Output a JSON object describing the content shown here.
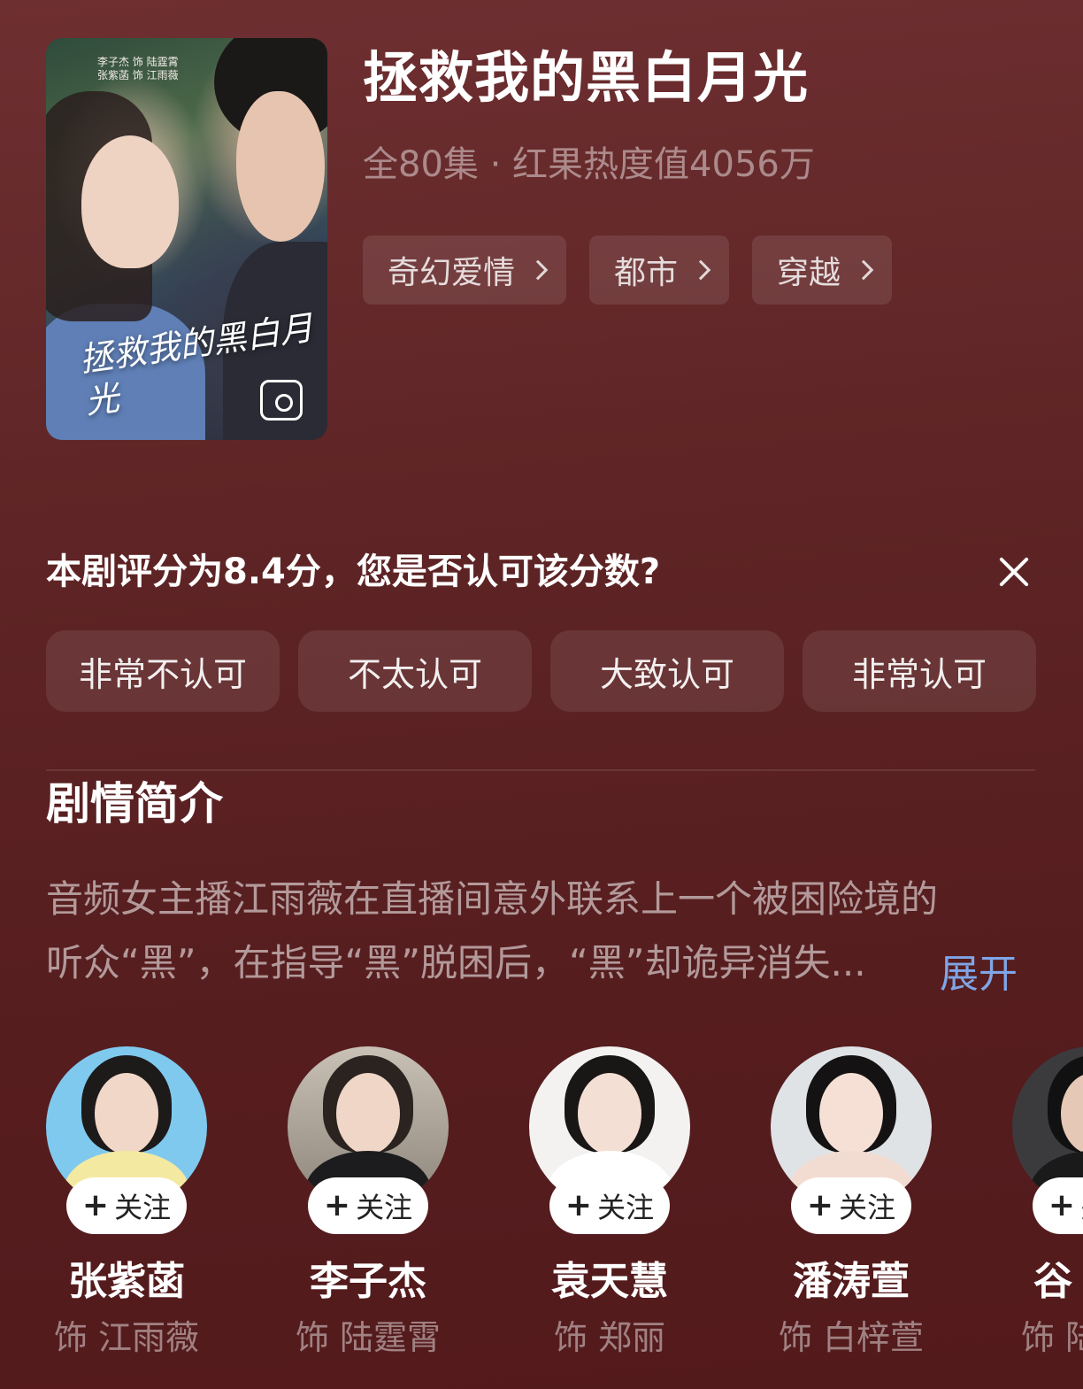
{
  "poster": {
    "credits_line1": "李子杰 饰 陆霆霄",
    "credits_line2": "张紫菡 饰 江雨薇",
    "calligraphy": "拯救我的黑白月光"
  },
  "show": {
    "title": "拯救我的黑白月光",
    "meta": "全80集 · 红果热度值4056万",
    "tags": [
      "奇幻爱情",
      "都市",
      "穿越"
    ]
  },
  "rating": {
    "question": "本剧评分为8.4分，您是否认可该分数?",
    "options": [
      "非常不认可",
      "不太认可",
      "大致认可",
      "非常认可"
    ]
  },
  "synopsis": {
    "title": "剧情简介",
    "line1": "音频女主播江雨薇在直播间意外联系上一个被困险境的",
    "line2": "听众“黑”，在指导“黑”脱困后，“黑”却诡异消失...",
    "expand_label": "展开"
  },
  "cast": {
    "follow_label": "关注",
    "members": [
      {
        "name": "张紫菡",
        "role": "饰 江雨薇"
      },
      {
        "name": "李子杰",
        "role": "饰 陆霆霄"
      },
      {
        "name": "袁天慧",
        "role": "饰 郑丽"
      },
      {
        "name": "潘涛萱",
        "role": "饰 白梓萱"
      },
      {
        "name": "谷",
        "role": "饰 陆"
      }
    ]
  },
  "colors": {
    "background_top": "#6e2f31",
    "background_bottom": "#531a1c",
    "expand_link": "#7fa5e6",
    "follow_button_bg": "#ffffff"
  },
  "icons": {
    "close": "close-icon",
    "tag_arrow": "chevron-right-icon",
    "poster_badge": "photo-icon",
    "follow": "plus-icon"
  }
}
